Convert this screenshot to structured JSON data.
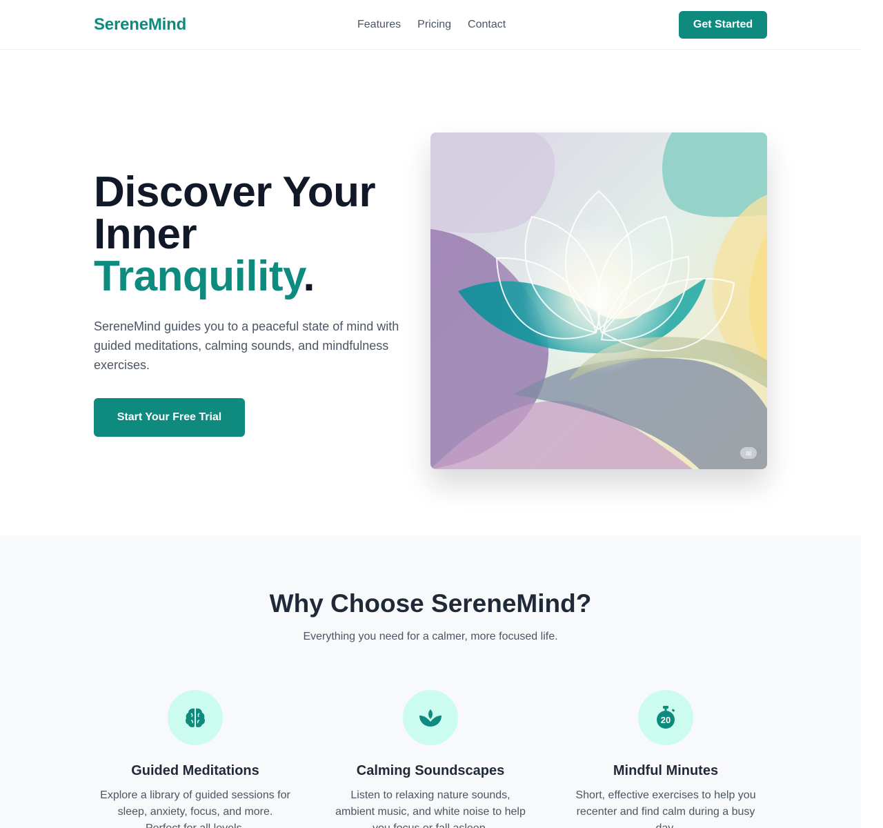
{
  "header": {
    "logo": "SereneMind",
    "nav": [
      "Features",
      "Pricing",
      "Contact"
    ],
    "cta": "Get Started"
  },
  "hero": {
    "title_line1": "Discover Your",
    "title_line2": "Inner",
    "title_accent": "Tranquility",
    "title_period": ".",
    "description": "SereneMind guides you to a peaceful state of mind with guided meditations, calming sounds, and mindfulness exercises.",
    "cta": "Start Your Free Trial",
    "image_badge": "ai"
  },
  "features": {
    "title": "Why Choose SereneMind?",
    "subtitle": "Everything you need for a calmer, more focused life.",
    "items": [
      {
        "icon": "brain-icon",
        "title": "Guided Meditations",
        "text": "Explore a library of guided sessions for sleep, anxiety, focus, and more. Perfect for all levels."
      },
      {
        "icon": "lotus-icon",
        "title": "Calming Soundscapes",
        "text": "Listen to relaxing nature sounds, ambient music, and white noise to help you focus or fall asleep."
      },
      {
        "icon": "stopwatch-icon",
        "title": "Mindful Minutes",
        "text": "Short, effective exercises to help you recenter and find calm during a busy day."
      }
    ],
    "timer_icon_text": "20"
  },
  "colors": {
    "brand": "#0f8a7e",
    "icon_bg": "#ccfbef",
    "heading": "#111827",
    "body_text": "#4b5563",
    "section_bg": "#f8f9fb"
  }
}
